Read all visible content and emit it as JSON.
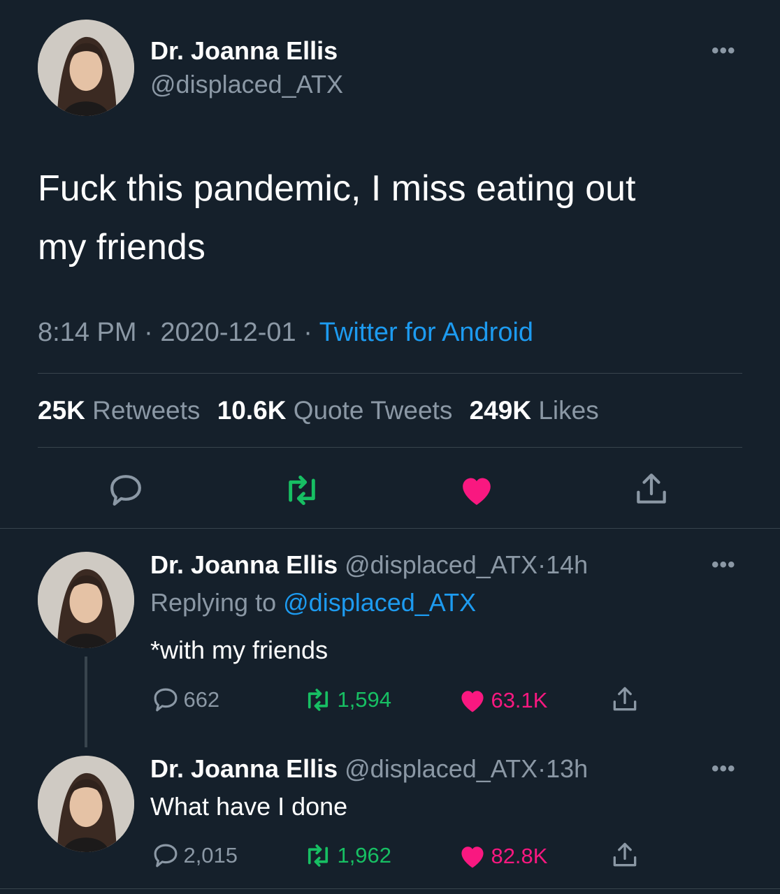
{
  "main_tweet": {
    "display_name": "Dr. Joanna Ellis",
    "handle": "@displaced_ATX",
    "text_line1": "Fuck this pandemic, I miss eating out",
    "text_line2": "my friends",
    "time": "8:14 PM",
    "date": "2020-12-01",
    "separator": "·",
    "source": "Twitter for Android",
    "stats": {
      "retweets_count": "25K",
      "retweets_label": "Retweets",
      "quotes_count": "10.6K",
      "quotes_label": "Quote Tweets",
      "likes_count": "249K",
      "likes_label": "Likes"
    }
  },
  "reply1": {
    "display_name": "Dr. Joanna Ellis",
    "handle": "@displaced_ATX",
    "separator": "·",
    "time": "14h",
    "replying_label": "Replying to",
    "replying_handle": "@displaced_ATX",
    "text": "*with my friends",
    "replies": "662",
    "retweets": "1,594",
    "likes": "63.1K"
  },
  "reply2": {
    "display_name": "Dr. Joanna Ellis",
    "handle": "@displaced_ATX",
    "separator": "·",
    "time": "13h",
    "text": "What have I done",
    "replies": "2,015",
    "retweets": "1,962",
    "likes": "82.8K"
  },
  "more_glyph": "•••",
  "colors": {
    "background": "#15202b",
    "text": "#ffffff",
    "muted": "#8b98a5",
    "link": "#1d9bf0",
    "retweet": "#17bf63",
    "like": "#f91880",
    "divider": "#38444d"
  },
  "icons": [
    "reply-icon",
    "retweet-icon",
    "like-icon",
    "share-icon",
    "more-icon"
  ]
}
